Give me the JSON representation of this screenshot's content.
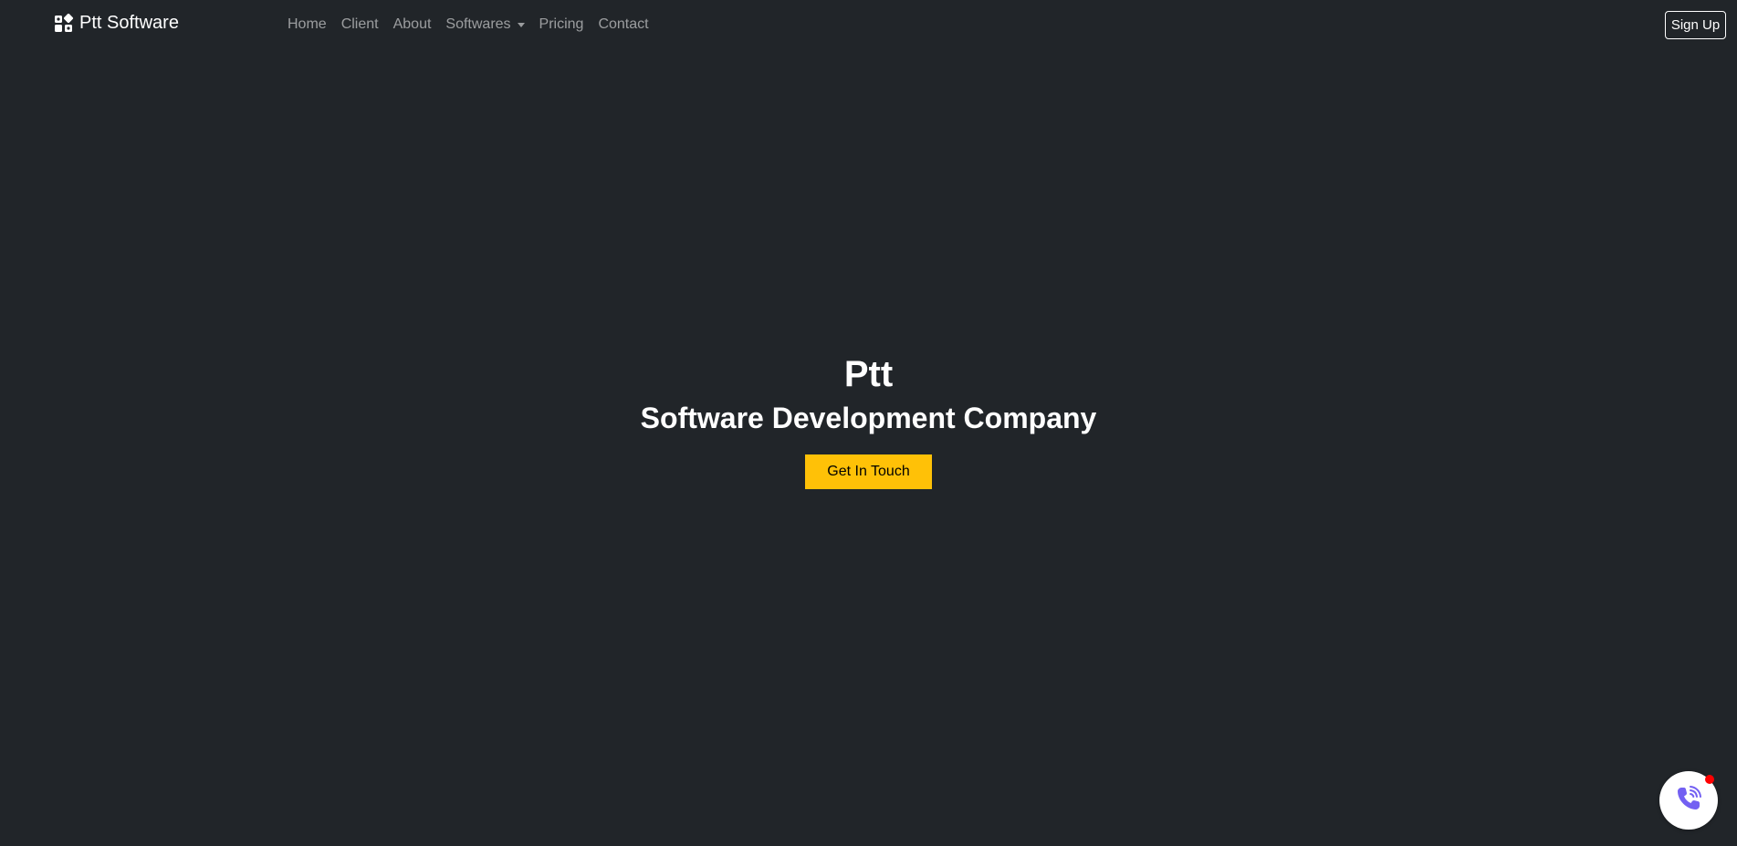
{
  "navbar": {
    "brand": "Ptt Software",
    "brand_icon": "puzzle-logo-icon",
    "links": [
      "Home",
      "Client",
      "About",
      "Softwares",
      "Pricing",
      "Contact"
    ],
    "signup_label": "Sign Up"
  },
  "hero": {
    "title": "Ptt",
    "subtitle": "Software Development Company",
    "cta_label": "Get In Touch"
  },
  "floating": {
    "icon": "viber-phone-icon"
  },
  "colors": {
    "background": "#212529",
    "accent": "#ffc107",
    "viber": "#7360f2",
    "notification": "#ff0000"
  }
}
